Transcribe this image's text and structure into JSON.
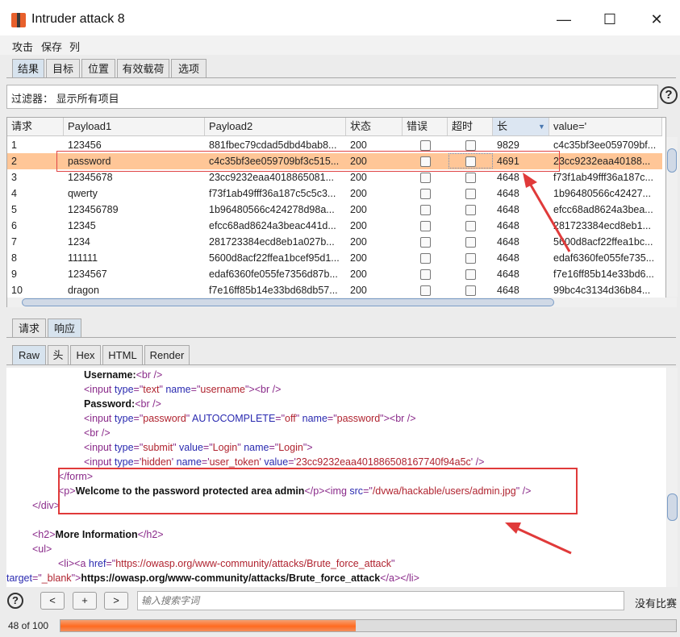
{
  "window": {
    "title": "Intruder attack 8"
  },
  "menu": [
    "攻击",
    "保存",
    "列"
  ],
  "top_tabs": [
    "结果",
    "目标",
    "位置",
    "有效载荷",
    "选项"
  ],
  "filter": {
    "label": "过滤器：",
    "value": "显示所有项目"
  },
  "table": {
    "headers": [
      "请求",
      "Payload1",
      "Payload2",
      "状态",
      "错误",
      "超时",
      "长",
      "value='"
    ],
    "sort_indicator": "▼",
    "rows": [
      {
        "id": "1",
        "p1": "123456",
        "p2": "881fbec79cdad5dbd4bab8...",
        "status": "200",
        "len": "9829",
        "value": "c4c35bf3ee059709bf..."
      },
      {
        "id": "2",
        "p1": "password",
        "p2": "c4c35bf3ee059709bf3c515...",
        "status": "200",
        "len": "4691",
        "value": "23cc9232eaa40188..."
      },
      {
        "id": "3",
        "p1": "12345678",
        "p2": "23cc9232eaa4018865081...",
        "status": "200",
        "len": "4648",
        "value": "f73f1ab49fff36a187c..."
      },
      {
        "id": "4",
        "p1": "qwerty",
        "p2": "f73f1ab49fff36a187c5c5c3...",
        "status": "200",
        "len": "4648",
        "value": "1b96480566c42427..."
      },
      {
        "id": "5",
        "p1": "123456789",
        "p2": "1b96480566c424278d98a...",
        "status": "200",
        "len": "4648",
        "value": "efcc68ad8624a3bea..."
      },
      {
        "id": "6",
        "p1": "12345",
        "p2": "efcc68ad8624a3beac441d...",
        "status": "200",
        "len": "4648",
        "value": "281723384ecd8eb1..."
      },
      {
        "id": "7",
        "p1": "1234",
        "p2": "281723384ecd8eb1a027b...",
        "status": "200",
        "len": "4648",
        "value": "5600d8acf22ffea1bc..."
      },
      {
        "id": "8",
        "p1": "111111",
        "p2": "5600d8acf22ffea1bcef95d1...",
        "status": "200",
        "len": "4648",
        "value": "edaf6360fe055fe735..."
      },
      {
        "id": "9",
        "p1": "1234567",
        "p2": "edaf6360fe055fe7356d87b...",
        "status": "200",
        "len": "4648",
        "value": "f7e16ff85b14e33bd6..."
      },
      {
        "id": "10",
        "p1": "dragon",
        "p2": "f7e16ff85b14e33bd68db57...",
        "status": "200",
        "len": "4648",
        "value": "99bc4c3134d36b84..."
      }
    ]
  },
  "lower_tabs": [
    "请求",
    "响应"
  ],
  "view_tabs": [
    "Raw",
    "头",
    "Hex",
    "HTML",
    "Render"
  ],
  "code": {
    "l1_text": "Username:",
    "l1_tag": "<br />",
    "l2": [
      "<input ",
      "type",
      "=\"",
      "text",
      "\" ",
      "name",
      "=\"",
      "username",
      "\">",
      "<br />"
    ],
    "l3_text": "Password:",
    "l3_tag": "<br />",
    "l4": [
      "<input ",
      "type",
      "=\"",
      "password",
      "\" ",
      "AUTOCOMPLETE",
      "=\"",
      "off",
      "\" ",
      "name",
      "=\"",
      "password",
      "\">",
      "<br />"
    ],
    "l5": "<br />",
    "l6": [
      "<input ",
      "type",
      "=\"",
      "submit",
      "\" ",
      "value",
      "=\"",
      "Login",
      "\" ",
      "name",
      "=\"",
      "Login",
      "\">"
    ],
    "l7": [
      "<input ",
      "type",
      "='",
      "hidden",
      "' ",
      "name",
      "='",
      "user_token",
      "' ",
      "value",
      "='",
      "23cc9232eaa401886508167740f94a5c",
      "' />"
    ],
    "l8": "</form>",
    "l9_open": "<p>",
    "l9_text": "Welcome to the password protected area admin",
    "l9_close": "</p>",
    "l9_img": "<img ",
    "l9_src": "src",
    "l9_eq": "=\"",
    "l9_srcval": "/dvwa/hackable/users/admin.jpg",
    "l9_end": "\" />",
    "l10": "</div>",
    "l12_open": "<h2>",
    "l12_text": "More Information",
    "l12_close": "</h2>",
    "l13": "<ul>",
    "l14_li": "<li>",
    "l14_a": "<a ",
    "l14_href": "href",
    "l14_eq": "=\"",
    "l14_hrefval": "https://owasp.org/www-community/attacks/Brute_force_attack",
    "l14_q": "\"",
    "l15_target": "target",
    "l15_eq": "=\"",
    "l15_targetval": "_blank",
    "l15_q": "\">",
    "l15_text": "https://owasp.org/www-community/attacks/Brute_force_attack",
    "l15_close": "</a></li>"
  },
  "bottom": {
    "help": "?",
    "prev": "<",
    "add": "+",
    "next": ">",
    "search_placeholder": "输入搜索字词",
    "no_match": "没有比赛",
    "progress_text": "48 of 100",
    "progress_fraction": 0.48
  },
  "colors": {
    "highlight_row": "#ffc697",
    "progress": "#ff6a20",
    "annotation": "#e03a3a"
  }
}
